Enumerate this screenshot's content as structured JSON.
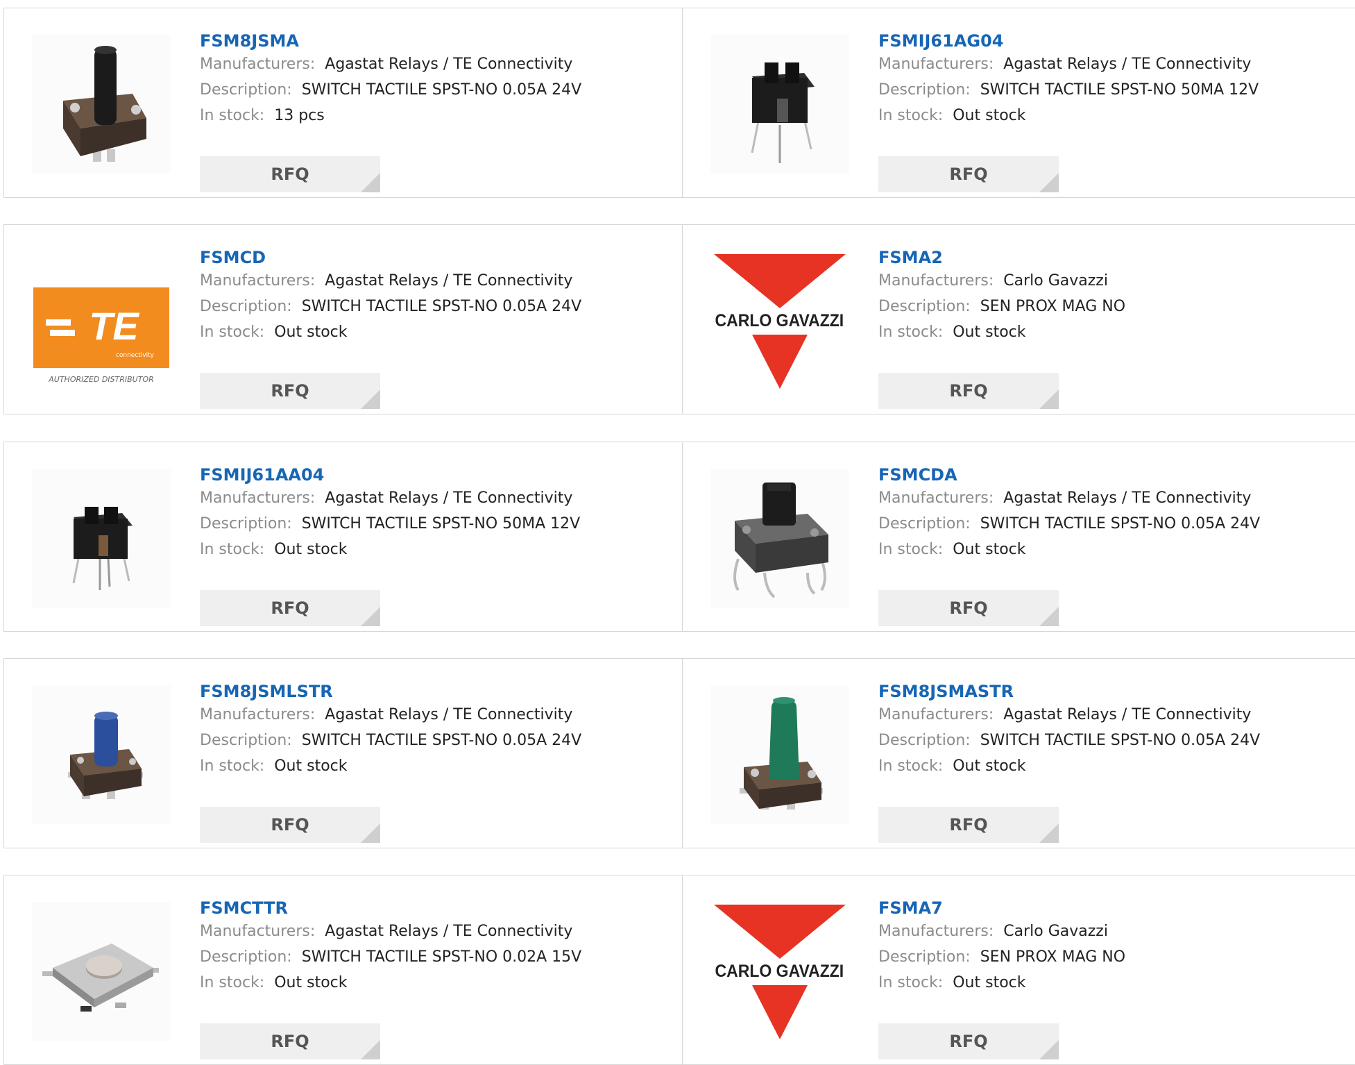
{
  "labels": {
    "manufacturers": "Manufacturers:",
    "description": "Description:",
    "in_stock": "In stock:",
    "rfq": "RFQ"
  },
  "products": [
    {
      "part": "FSM8JSMA",
      "manufacturer": "Agastat Relays / TE Connectivity",
      "description": "SWITCH TACTILE SPST-NO 0.05A 24V",
      "stock": "13 pcs",
      "image": "tactile-switch-black-tall"
    },
    {
      "part": "FSMIJ61AG04",
      "manufacturer": "Agastat Relays / TE Connectivity",
      "description": "SWITCH TACTILE SPST-NO 50MA 12V",
      "stock": "Out stock",
      "image": "tactile-switch-illuminated-pcb"
    },
    {
      "part": "FSMCD",
      "manufacturer": "Agastat Relays / TE Connectivity",
      "description": "SWITCH TACTILE SPST-NO 0.05A 24V",
      "stock": "Out stock",
      "image": "te-connectivity-logo",
      "logo": {
        "mark": "TE",
        "sub": "connectivity",
        "caption": "AUTHORIZED DISTRIBUTOR",
        "color": "#f28c1e"
      }
    },
    {
      "part": "FSMA2",
      "manufacturer": "Carlo Gavazzi",
      "description": "SEN PROX MAG NO",
      "stock": "Out stock",
      "image": "carlo-gavazzi-logo",
      "logo": {
        "text": "CARLO GAVAZZI",
        "color": "#e63323"
      }
    },
    {
      "part": "FSMIJ61AA04",
      "manufacturer": "Agastat Relays / TE Connectivity",
      "description": "SWITCH TACTILE SPST-NO 50MA 12V",
      "stock": "Out stock",
      "image": "tactile-switch-illuminated-pcb"
    },
    {
      "part": "FSMCDA",
      "manufacturer": "Agastat Relays / TE Connectivity",
      "description": "SWITCH TACTILE SPST-NO 0.05A 24V",
      "stock": "Out stock",
      "image": "tactile-switch-square-cap"
    },
    {
      "part": "FSM8JSMLSTR",
      "manufacturer": "Agastat Relays / TE Connectivity",
      "description": "SWITCH TACTILE SPST-NO 0.05A 24V",
      "stock": "Out stock",
      "image": "tactile-switch-blue-cap"
    },
    {
      "part": "FSM8JSMASTR",
      "manufacturer": "Agastat Relays / TE Connectivity",
      "description": "SWITCH TACTILE SPST-NO 0.05A 24V",
      "stock": "Out stock",
      "image": "tactile-switch-green-tall"
    },
    {
      "part": "FSMCTTR",
      "manufacturer": "Agastat Relays / TE Connectivity",
      "description": "SWITCH TACTILE SPST-NO 0.02A 15V",
      "stock": "Out stock",
      "image": "tactile-switch-low-profile-metal"
    },
    {
      "part": "FSMA7",
      "manufacturer": "Carlo Gavazzi",
      "description": "SEN PROX MAG NO",
      "stock": "Out stock",
      "image": "carlo-gavazzi-logo",
      "logo": {
        "text": "CARLO GAVAZZI",
        "color": "#e63323"
      }
    }
  ],
  "colors": {
    "link": "#1766b5",
    "label": "#8b8b8b",
    "value": "#222222",
    "button_bg": "#efefef",
    "border": "#d6d6d6"
  }
}
